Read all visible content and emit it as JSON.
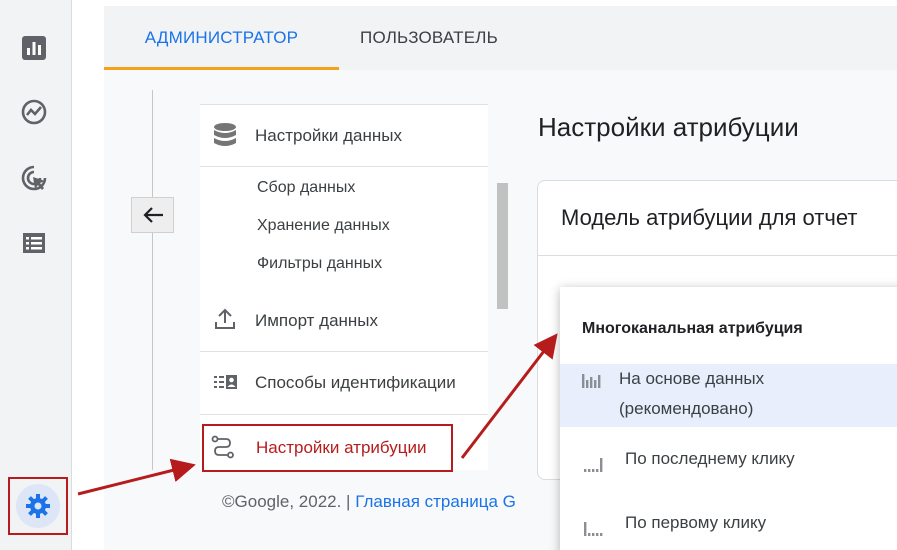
{
  "tabs": {
    "admin_label": "АДМИНИСТРАТОР",
    "user_label": "ПОЛЬЗОВАТЕЛЬ"
  },
  "rail": {
    "icons": [
      "reports-icon",
      "explore-icon",
      "advertising-icon",
      "configure-icon"
    ],
    "settings_icon": "gear-icon"
  },
  "menu": {
    "data_settings": "Настройки данных",
    "data_collection": "Сбор данных",
    "data_retention": "Хранение данных",
    "data_filters": "Фильтры данных",
    "data_import": "Импорт данных",
    "reporting_identity": "Способы идентификации",
    "attribution_settings": "Настройки атрибуции"
  },
  "footer": {
    "copyright": "©Google, 2022. | ",
    "home_link": "Главная страница G"
  },
  "page": {
    "title": "Настройки атрибуции",
    "card_title": "Модель атрибуции для отчет"
  },
  "dropdown": {
    "header": "Многоканальная атрибуция",
    "option1_line1": "На основе данных",
    "option1_line2": "(рекомендовано)",
    "option2": "По последнему клику",
    "option3": "По первому клику"
  },
  "colors": {
    "accent_blue": "#1a73e8",
    "tab_indicator": "#f4a11b",
    "highlight_red": "#b71c1c",
    "selected_bg": "#e8eefb"
  }
}
